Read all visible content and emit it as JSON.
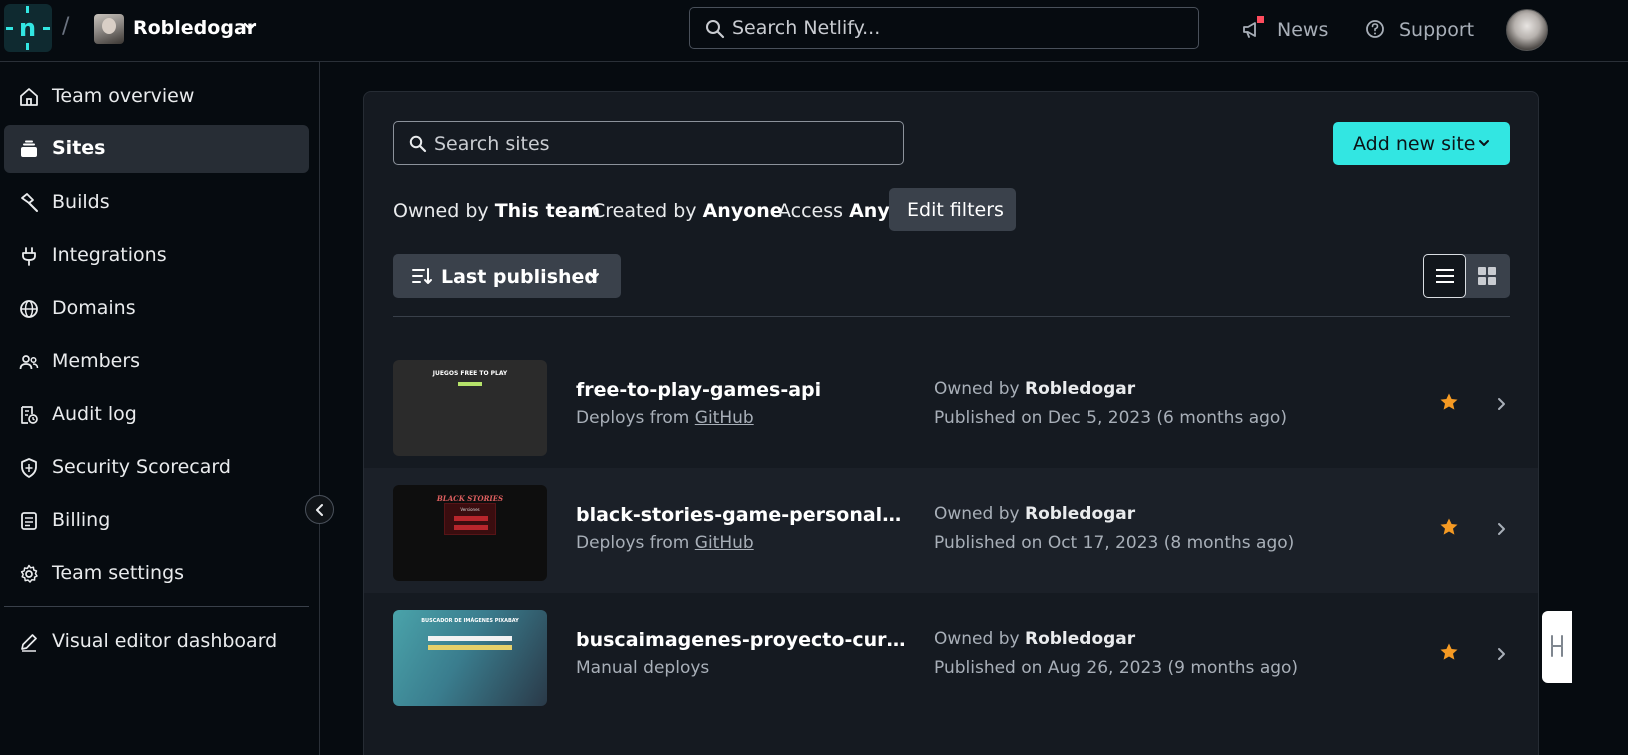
{
  "topbar": {
    "team_name": "Robledogar",
    "search_placeholder": "Search Netlify...",
    "news_label": "News",
    "support_label": "Support"
  },
  "sidebar": {
    "items": [
      {
        "label": "Team overview",
        "icon": "home-icon"
      },
      {
        "label": "Sites",
        "icon": "stack-icon",
        "active": true
      },
      {
        "label": "Builds",
        "icon": "hammer-icon"
      },
      {
        "label": "Integrations",
        "icon": "plug-icon"
      },
      {
        "label": "Domains",
        "icon": "globe-icon"
      },
      {
        "label": "Members",
        "icon": "users-icon"
      },
      {
        "label": "Audit log",
        "icon": "audit-log-icon"
      },
      {
        "label": "Security Scorecard",
        "icon": "shield-icon"
      },
      {
        "label": "Billing",
        "icon": "billing-icon"
      },
      {
        "label": "Team settings",
        "icon": "gear-icon"
      }
    ],
    "footer_item": {
      "label": "Visual editor dashboard",
      "icon": "pencil-icon"
    }
  },
  "main": {
    "search_placeholder": "Search sites",
    "add_site_label": "Add new site",
    "filters": [
      {
        "label": "Owned by",
        "value": "This team"
      },
      {
        "label": "Created by",
        "value": "Anyone"
      },
      {
        "label": "Access",
        "value": "Any"
      }
    ],
    "edit_filters_label": "Edit filters",
    "sort_label": "Last published",
    "sites": [
      {
        "name": "free-to-play-games-api",
        "deploy_prefix": "Deploys from",
        "deploy_link": "GitHub",
        "owner_prefix": "Owned by",
        "owner": "Robledogar",
        "published": "Published on Dec 5, 2023 (6 months ago)",
        "thumb_title": "JUEGOS FREE TO PLAY",
        "starred": true
      },
      {
        "name": "black-stories-game-personal-project",
        "deploy_prefix": "Deploys from",
        "deploy_link": "GitHub",
        "owner_prefix": "Owned by",
        "owner": "Robledogar",
        "published": "Published on Oct 17, 2023 (8 months ago)",
        "thumb_title": "BLACK STORIES",
        "thumb_sub": "Versiones",
        "starred": true
      },
      {
        "name": "buscaimagenes-proyecto-cursojsmo...",
        "deploy_prefix": "Manual deploys",
        "deploy_link": "",
        "owner_prefix": "Owned by",
        "owner": "Robledogar",
        "published": "Published on Aug 26, 2023 (9 months ago)",
        "thumb_title": "BUSCADOR DE IMÁGENES PIXABAY",
        "starred": true
      }
    ]
  },
  "colors": {
    "accent": "#32e6e2",
    "background": "#060b10",
    "panel": "#151a21",
    "star": "#f59a23",
    "news_badge": "#ff4c5e"
  }
}
